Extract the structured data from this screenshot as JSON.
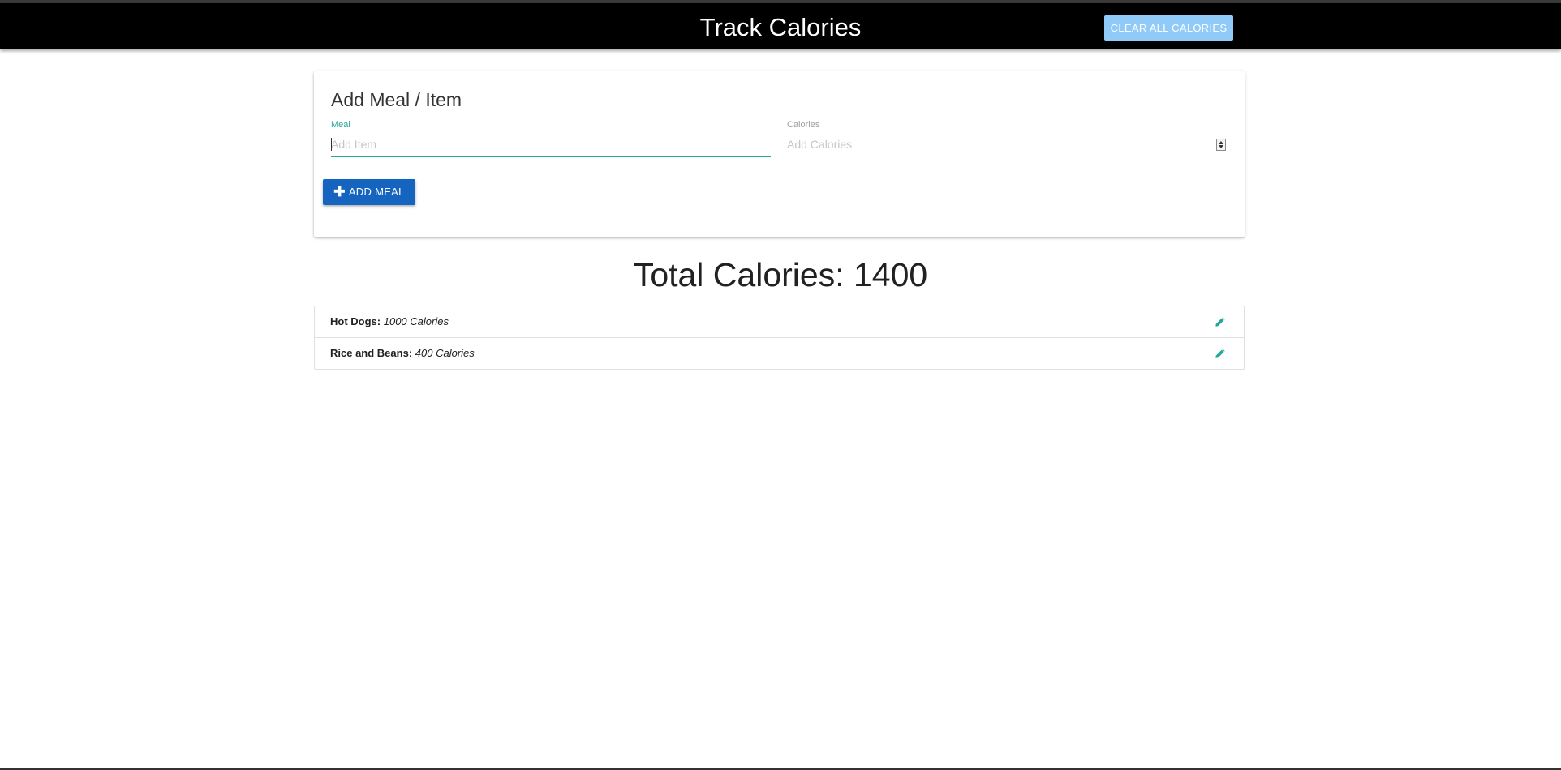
{
  "navbar": {
    "title": "Track Calories",
    "clear_label": "Clear All Calories"
  },
  "form": {
    "title": "Add Meal / Item",
    "meal_label": "Meal",
    "meal_placeholder": "Add Item",
    "meal_value": "",
    "calories_label": "Calories",
    "calories_placeholder": "Add Calories",
    "calories_value": "",
    "add_label": "Add Meal"
  },
  "total": {
    "text": "Total Calories: 1400"
  },
  "items": [
    {
      "name": "Hot Dogs:",
      "calories": "1000 Calories"
    },
    {
      "name": "Rice and Beans:",
      "calories": "400 Calories"
    }
  ],
  "colors": {
    "navbar_bg": "#000000",
    "clear_button": "#90caf9",
    "add_button": "#1565c0",
    "accent": "#26a69a"
  },
  "icons": {
    "add_button_icon": "plus-icon",
    "item_action_icon": "pencil-icon"
  }
}
